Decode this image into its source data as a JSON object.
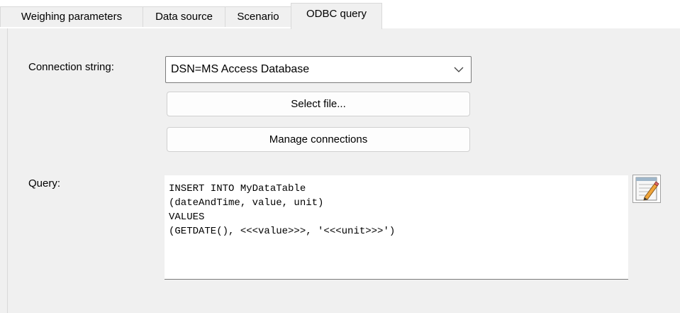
{
  "tabs": [
    {
      "label": "Weighing parameters",
      "active": false
    },
    {
      "label": "Data source",
      "active": false
    },
    {
      "label": "Scenario",
      "active": false
    },
    {
      "label": "ODBC query",
      "active": true
    }
  ],
  "form": {
    "connection_label": "Connection string:",
    "connection_value": "DSN=MS Access Database",
    "select_file_label": "Select file...",
    "manage_connections_label": "Manage connections",
    "query_label": "Query:",
    "query_text": "INSERT INTO MyDataTable\n(dateAndTime, value, unit)\nVALUES\n(GETDATE(), <<<value>>>, '<<<unit>>>')"
  },
  "icons": {
    "dropdown": "chevron-down-icon",
    "edit_query": "notepad-pencil-icon"
  }
}
